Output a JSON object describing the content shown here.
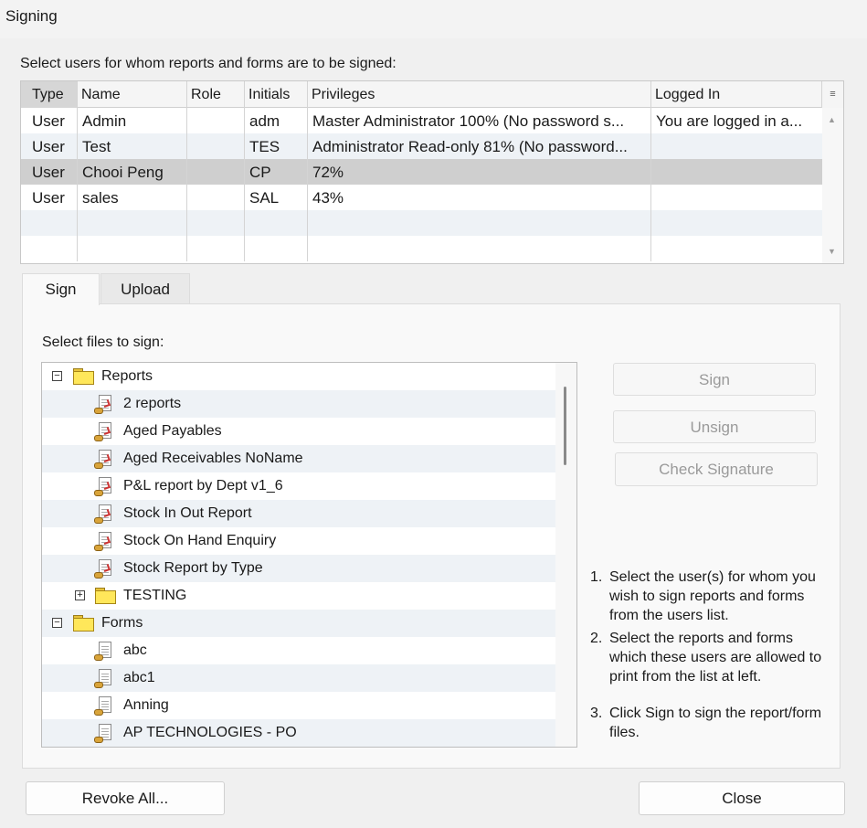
{
  "window": {
    "title": "Signing"
  },
  "users_caption": "Select users for whom reports and forms are to be signed:",
  "users_table": {
    "columns": [
      "Type",
      "Name",
      "Role",
      "Initials",
      "Privileges",
      "Logged In"
    ],
    "rows": [
      [
        "User",
        "Admin",
        "",
        "adm",
        "Master Administrator 100% (No password s...",
        "You are logged in a..."
      ],
      [
        "User",
        "Test",
        "",
        "TES",
        "Administrator Read-only 81% (No password...",
        ""
      ],
      [
        "User",
        "Chooi Peng",
        "",
        "CP",
        "72%",
        ""
      ],
      [
        "User",
        "sales",
        "",
        "SAL",
        "43%",
        ""
      ]
    ]
  },
  "tabs": [
    "Sign",
    "Upload"
  ],
  "files_caption": "Select files to sign:",
  "tree": [
    {
      "kind": "folder",
      "label": "Reports",
      "toggle": "−"
    },
    {
      "kind": "report",
      "label": "2 reports"
    },
    {
      "kind": "report",
      "label": "Aged Payables"
    },
    {
      "kind": "report",
      "label": "Aged Receivables NoName"
    },
    {
      "kind": "report",
      "label": "P&L report by Dept v1_6"
    },
    {
      "kind": "report",
      "label": "Stock In Out Report"
    },
    {
      "kind": "report",
      "label": "Stock On Hand Enquiry"
    },
    {
      "kind": "report",
      "label": "Stock Report by Type"
    },
    {
      "kind": "subfolder",
      "label": "TESTING",
      "toggle": "+"
    },
    {
      "kind": "folder",
      "label": "Forms",
      "toggle": "−"
    },
    {
      "kind": "form",
      "label": "abc"
    },
    {
      "kind": "form",
      "label": "abc1"
    },
    {
      "kind": "form",
      "label": "Anning"
    },
    {
      "kind": "form",
      "label": "AP TECHNOLOGIES - PO"
    }
  ],
  "buttons": {
    "sign": "Sign",
    "unsign": "Unsign",
    "check_signature": "Check Signature",
    "revoke_all": "Revoke All...",
    "close": "Close"
  },
  "instructions": [
    {
      "num": "1.",
      "text": "Select the user(s) for whom you wish to sign reports and forms from the users list."
    },
    {
      "num": "2.",
      "text": "Select the reports and forms which these users are allowed to print from the list at left."
    },
    {
      "num": "3.",
      "text": "Click Sign to sign the report/form files."
    }
  ],
  "icons": {
    "column_chooser": "column-chooser-icon",
    "folder": "folder-icon",
    "report": "signed-report-icon",
    "form": "form-file-icon"
  },
  "colors": {
    "window_bg": "#f0f0f0",
    "alt_row": "#eef2f6",
    "selected_row": "#cfcfcf",
    "folder": "#ffe75a"
  }
}
